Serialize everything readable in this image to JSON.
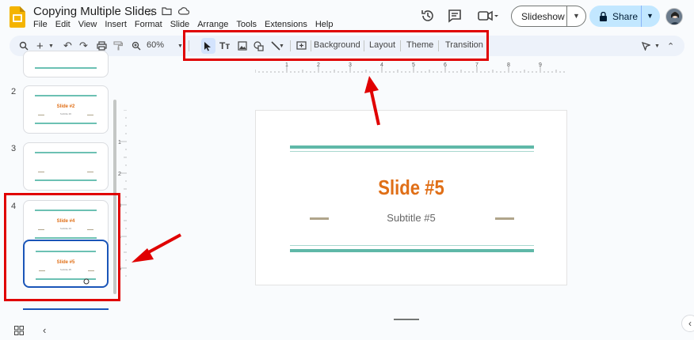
{
  "app": {
    "title": "Copying Multiple Slides",
    "menu": [
      "File",
      "Edit",
      "View",
      "Insert",
      "Format",
      "Slide",
      "Arrange",
      "Tools",
      "Extensions",
      "Help"
    ]
  },
  "header": {
    "slideshow_label": "Slideshow",
    "share_label": "Share"
  },
  "toolbar": {
    "zoom": "60%",
    "background": "Background",
    "layout": "Layout",
    "theme": "Theme",
    "transition": "Transition"
  },
  "filmstrip": {
    "slides": [
      {
        "number": "2",
        "title": "Slide #2",
        "subtitle": "Subtitle #2"
      },
      {
        "number": "3",
        "title": "",
        "subtitle": ""
      },
      {
        "number": "4",
        "title": "Slide #4",
        "subtitle": "Subtitle #4"
      },
      {
        "number": "",
        "title": "Slide #5",
        "subtitle": "Subtitle #5"
      }
    ]
  },
  "ruler": {
    "top_labels": [
      "1",
      "2",
      "3",
      "4",
      "5",
      "6",
      "7",
      "8",
      "9"
    ],
    "left_labels": [
      "1",
      "2",
      "3",
      "4",
      "5"
    ]
  },
  "slide": {
    "title": "Slide #5",
    "subtitle": "Subtitle #5"
  },
  "colors": {
    "accent_orange": "#e06f17",
    "line_teal": "#5fb8a8",
    "annotation_red": "#e00000",
    "share_blue": "#c2e7ff"
  }
}
